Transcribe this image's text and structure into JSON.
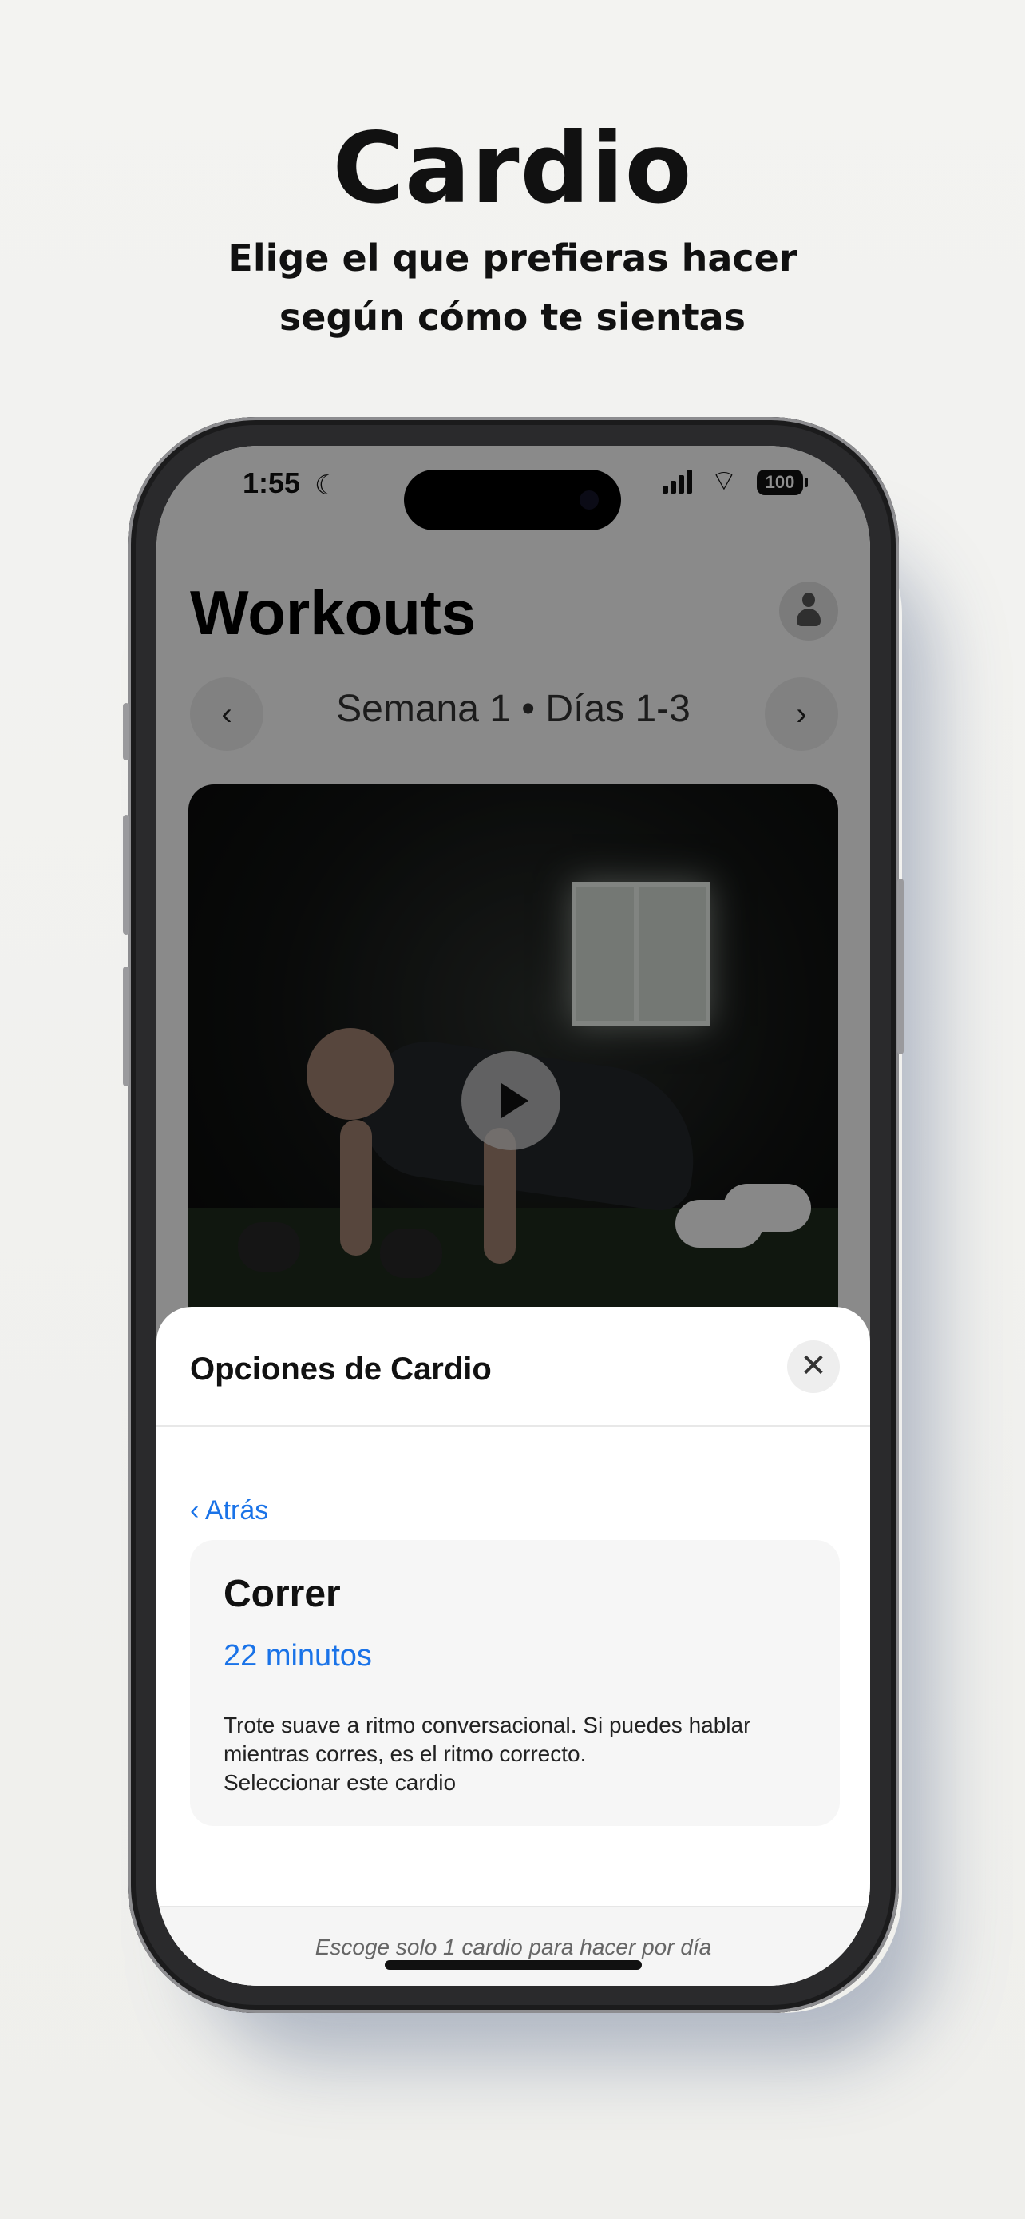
{
  "promo": {
    "title": "Cardio",
    "subtitle_line1": "Elige el que prefieras hacer",
    "subtitle_line2": "según cómo te sientas"
  },
  "status_bar": {
    "time": "1:55",
    "battery": "100"
  },
  "workouts": {
    "title": "Workouts",
    "week_label": "Semana 1 • Días 1-3",
    "prev_icon": "‹",
    "next_icon": "›"
  },
  "sheet": {
    "title": "Opciones de Cardio",
    "close_icon": "✕",
    "back_label": "‹ Atrás",
    "option": {
      "name": "Correr",
      "duration": "22 minutos",
      "description_line1": "Trote suave a ritmo conversacional. Si puedes hablar",
      "description_line2": "mientras corres, es el ritmo correcto.",
      "select_label": "Seleccionar este cardio"
    },
    "footer_note": "Escoge solo 1 cardio para hacer por día"
  },
  "colors": {
    "accent": "#1a73e8",
    "overlay": "rgba(0,0,0,0.44)"
  }
}
